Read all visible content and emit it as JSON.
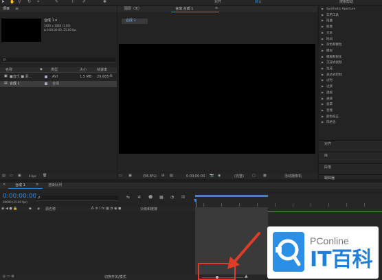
{
  "project": {
    "title": "项目",
    "menu": "≡",
    "comp_name": "合成 1 ▾",
    "comp_info": [
      "1920 x 1080 (1.00)",
      "Δ 0:00:30:00, 25.00 fps"
    ],
    "search_placeholder": "ρ.",
    "columns": [
      "名称",
      "类型",
      "大小",
      "帧速率"
    ],
    "items": [
      {
        "name": "■音乐  ■  素...",
        "type": "AVI",
        "size": "1.5 MB",
        "fps": "29.685"
      },
      {
        "name": "合成 1",
        "type": "合成",
        "size": "",
        "fps": ""
      }
    ],
    "bpc": "8 bpc"
  },
  "toolbar": {
    "align": "对齐",
    "workspace": "默认",
    "search_help": "搜索帮助"
  },
  "viewer": {
    "layer_tab": "图层（无）",
    "comp_tab": "合成 合成 1",
    "crumb": "合成 1",
    "zoom": "(56.8%)",
    "timecode": "0:00:00:00",
    "quality": "(完整)",
    "camera": "活动摄像机"
  },
  "effects": {
    "items": [
      "Synthetic Aperture",
      "实用工具",
      "扭曲",
      "抠像",
      "文本",
      "时间",
      "杂色和颗粒",
      "模拟",
      "模糊和锐化",
      "沉浸式视频",
      "生成",
      "表达式控制",
      "过时",
      "过渡",
      "透视",
      "通道",
      "遮罩",
      "音频",
      "颜色校正",
      "风格化"
    ],
    "panels": [
      "对齐",
      "库",
      "段落",
      "跟踪器"
    ]
  },
  "timeline": {
    "tab": "合成 1",
    "render_queue": "渲染队列",
    "timecode": "0:00:00:00",
    "frames": "00000 (25.00 fps)",
    "search_placeholder": "ρ.",
    "col_source": "源名称",
    "col_parent": "父级和链接",
    "toggle_mode": "切换开关/模式"
  },
  "watermark": {
    "brand": "PConline",
    "name": "IT百科"
  },
  "colors": {
    "accent": "#2d8ceb",
    "bg": "#1d1d1d",
    "panel": "#232323",
    "red": "#e03c28"
  }
}
